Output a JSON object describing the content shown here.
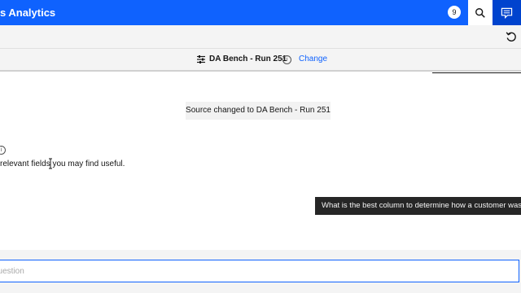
{
  "header": {
    "title": "s Analytics",
    "notification_count": "9",
    "search_icon": "search-icon",
    "chat_icon": "chat-icon"
  },
  "toolbar": {
    "reset_icon": "reset-icon"
  },
  "source": {
    "name": "DA Bench - Run 251",
    "info_glyph": "i",
    "change_label": "Change"
  },
  "conversation": {
    "toast": "Source changed to DA Bench - Run 251",
    "info_glyph": "i",
    "message": "relevant fields you may find useful."
  },
  "suggestion": {
    "text": "What is the best column to determine how a customer was a"
  },
  "chat": {
    "placeholder": "question"
  },
  "colors": {
    "brand": "#0f62fe",
    "brand_dark": "#0043ce",
    "tooltip": "#262626"
  }
}
